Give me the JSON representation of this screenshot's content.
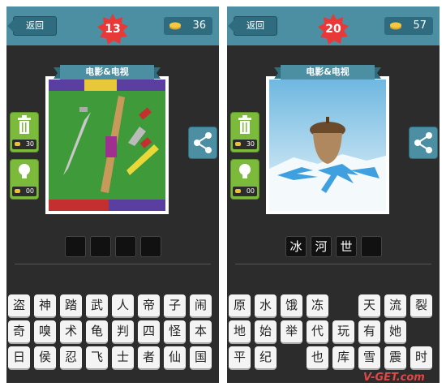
{
  "screens": [
    {
      "back_label": "返回",
      "level": "13",
      "coins": "36",
      "category": "电影&电视",
      "delete_cost": "30",
      "hint_cost": "00",
      "answer_slots": [
        "",
        "",
        "",
        ""
      ],
      "letters": [
        "盗",
        "神",
        "踏",
        "武",
        "人",
        "帝",
        "子",
        "闹",
        "奇",
        "嗅",
        "术",
        "龟",
        "判",
        "四",
        "怪",
        "本",
        "日",
        "侯",
        "忍",
        "飞",
        "士",
        "者",
        "仙",
        "国"
      ]
    },
    {
      "back_label": "返回",
      "level": "20",
      "coins": "57",
      "category": "电影&电视",
      "delete_cost": "30",
      "hint_cost": "00",
      "answer_slots": [
        "冰",
        "河",
        "世",
        ""
      ],
      "letters": [
        "原",
        "水",
        "饿",
        "冻",
        "",
        "天",
        "流",
        "裂",
        "地",
        "始",
        "举",
        "代",
        "玩",
        "有",
        "她",
        "",
        "平",
        "纪",
        "",
        "也",
        "库",
        "雪",
        "震",
        "时"
      ]
    }
  ],
  "watermark": "V-GET.com",
  "colors": {
    "topbar": "#4c8fa3",
    "background": "#2c2c2c",
    "level_badge": "#e83838",
    "green_button": "#7cba3c"
  }
}
